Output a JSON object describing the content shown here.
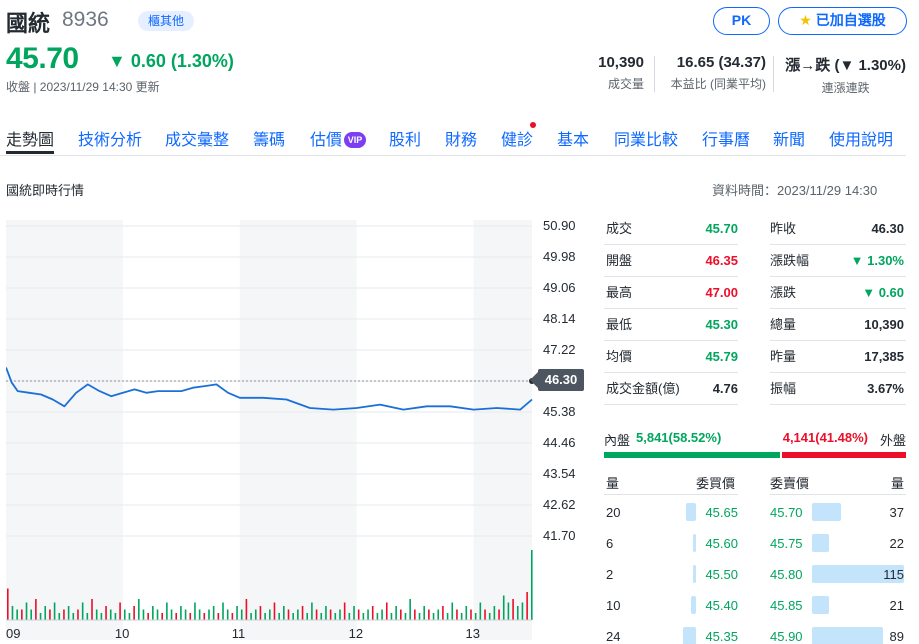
{
  "header": {
    "name": "國統",
    "code": "8936",
    "category": "櫃其他",
    "price": "45.70",
    "change": "▼ 0.60 (1.30%)",
    "status": "收盤 | 2023/11/29 14:30 更新",
    "pk_label": "PK",
    "watch_label": "已加自選股",
    "stats": [
      {
        "value": "10,390",
        "label": "成交量"
      },
      {
        "value": "16.65 (34.37)",
        "label": "本益比 (同業平均)"
      },
      {
        "value": "漲→跌 (▼ 1.30%)",
        "label": "連漲連跌"
      }
    ]
  },
  "tabs": [
    "走勢圖",
    "技術分析",
    "成交彙整",
    "籌碼",
    "估價",
    "股利",
    "財務",
    "健診",
    "基本",
    "同業比較",
    "行事曆",
    "新聞",
    "使用說明"
  ],
  "vip_label": "VIP",
  "section": {
    "title": "國統即時行情",
    "data_time": "資料時間：2023/11/29 14:30"
  },
  "chart_data": {
    "type": "line",
    "y_ticks": [
      "50.90",
      "49.98",
      "49.06",
      "48.14",
      "47.22",
      "45.38",
      "44.46",
      "43.54",
      "42.62",
      "41.70"
    ],
    "ylim": [
      41.7,
      50.9
    ],
    "x_ticks": [
      "09",
      "10",
      "11",
      "12",
      "13"
    ],
    "reference": "46.30",
    "x": [
      0,
      0.05,
      0.1,
      0.2,
      0.3,
      0.4,
      0.5,
      0.6,
      0.7,
      0.8,
      0.9,
      1.0,
      1.1,
      1.2,
      1.3,
      1.4,
      1.5,
      1.6,
      1.7,
      1.8,
      1.9,
      2.0,
      2.2,
      2.4,
      2.6,
      2.8,
      3.0,
      3.2,
      3.4,
      3.6,
      3.8,
      4.0,
      4.2,
      4.4,
      4.5
    ],
    "values": [
      46.7,
      46.25,
      46.0,
      45.95,
      45.9,
      45.75,
      45.55,
      45.95,
      46.2,
      46.0,
      45.85,
      45.95,
      46.05,
      45.95,
      46.0,
      46.0,
      46.0,
      46.1,
      46.15,
      46.2,
      45.95,
      45.8,
      45.8,
      45.75,
      45.5,
      45.45,
      45.5,
      45.6,
      45.45,
      45.55,
      45.55,
      45.45,
      45.5,
      45.45,
      45.75
    ],
    "volume": [
      9,
      4,
      3,
      3,
      5,
      3,
      6,
      2,
      4,
      3,
      5,
      2,
      3,
      4,
      2,
      3,
      5,
      2,
      6,
      3,
      2,
      4,
      3,
      2,
      5,
      3,
      2,
      4,
      6,
      3,
      2,
      4,
      3,
      2,
      5,
      3,
      2,
      4,
      3,
      2,
      5,
      3,
      2,
      3,
      4,
      2,
      5,
      3,
      2,
      4,
      3,
      6,
      2,
      3,
      4,
      2,
      3,
      5,
      2,
      4,
      3,
      2,
      3,
      4,
      2,
      5,
      3,
      2,
      4,
      3,
      2,
      3,
      5,
      2,
      4,
      3,
      2,
      3,
      4,
      2,
      3,
      5,
      2,
      4,
      3,
      2,
      6,
      3,
      2,
      4,
      3,
      2,
      3,
      4,
      2,
      5,
      3,
      2,
      4,
      3,
      2,
      5,
      3,
      2,
      4,
      3,
      7,
      5,
      6,
      4,
      5,
      8,
      20
    ],
    "colors": {
      "line": "#1b6fd8",
      "shade": "#f5f6f7",
      "up": "#eb0f29",
      "down": "#00a55e"
    }
  },
  "quote": {
    "rows": [
      {
        "l1": "成交",
        "v1": "45.70",
        "c1": "green",
        "l2": "昨收",
        "v2": "46.30",
        "c2": "black"
      },
      {
        "l1": "開盤",
        "v1": "46.35",
        "c1": "red",
        "l2": "漲跌幅",
        "v2": "▼ 1.30%",
        "c2": "green"
      },
      {
        "l1": "最高",
        "v1": "47.00",
        "c1": "red",
        "l2": "漲跌",
        "v2": "▼ 0.60",
        "c2": "green"
      },
      {
        "l1": "最低",
        "v1": "45.30",
        "c1": "green",
        "l2": "總量",
        "v2": "10,390",
        "c2": "black"
      },
      {
        "l1": "均價",
        "v1": "45.79",
        "c1": "green",
        "l2": "昨量",
        "v2": "17,385",
        "c2": "black"
      },
      {
        "l1": "成交金額(億)",
        "v1": "4.76",
        "c1": "black",
        "l2": "振幅",
        "v2": "3.67%",
        "c2": "black"
      }
    ]
  },
  "inner_outer": {
    "inner_label": "內盤",
    "inner_value": "5,841(58.52%)",
    "inner_fraction": 0.5852,
    "outer_value": "4,141(41.48%)",
    "outer_label": "外盤"
  },
  "orderbook": {
    "headers": {
      "buy_qty": "量",
      "buy_price": "委買價",
      "sell_price": "委賣價",
      "sell_qty": "量"
    },
    "rows": [
      {
        "bq": "20",
        "bp": "45.65",
        "sp": "45.70",
        "sq": "37",
        "bf": 0.17,
        "sf": 0.32
      },
      {
        "bq": "6",
        "bp": "45.60",
        "sp": "45.75",
        "sq": "22",
        "bf": 0.05,
        "sf": 0.19
      },
      {
        "bq": "2",
        "bp": "45.50",
        "sp": "45.80",
        "sq": "115",
        "bf": 0.02,
        "sf": 1.0
      },
      {
        "bq": "10",
        "bp": "45.40",
        "sp": "45.85",
        "sq": "21",
        "bf": 0.09,
        "sf": 0.18
      },
      {
        "bq": "24",
        "bp": "45.35",
        "sp": "45.90",
        "sq": "89",
        "bf": 0.21,
        "sf": 0.77
      }
    ]
  }
}
